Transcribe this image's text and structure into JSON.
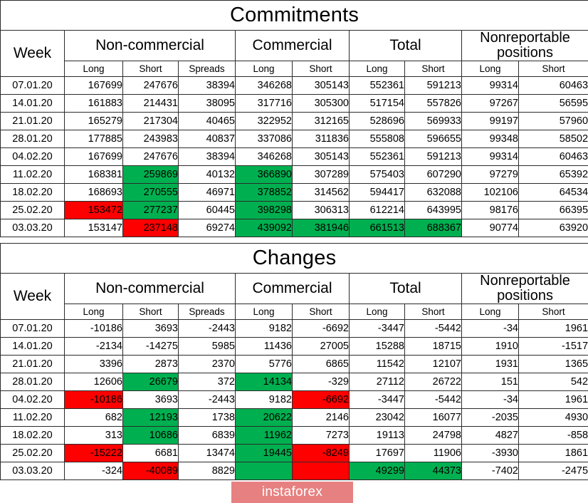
{
  "colors": {
    "highlight_green": "#00b050",
    "highlight_red": "#ff0000",
    "grid": "#2b2b2b",
    "watermark_bg": "#e05c5c"
  },
  "watermark": {
    "label": "instaforex"
  },
  "headers": {
    "week": "Week",
    "groups": {
      "noncommercial": "Non-commercial",
      "commercial": "Commercial",
      "total": "Total",
      "nonreportable_line1": "Nonreportable",
      "nonreportable_line2": "positions"
    },
    "sub": {
      "long": "Long",
      "short": "Short",
      "spreads": "Spreads"
    }
  },
  "tables": [
    {
      "title": "Commitments",
      "columns": [
        "Week",
        "Long",
        "Short",
        "Spreads",
        "Long",
        "Short",
        "Long",
        "Short",
        "Long",
        "Short"
      ],
      "rows": [
        {
          "week": "07.01.20",
          "values": [
            "167699",
            "247676",
            "38394",
            "346268",
            "305143",
            "552361",
            "591213",
            "99314",
            "60463"
          ],
          "highlight": [
            null,
            null,
            null,
            null,
            null,
            null,
            null,
            null,
            null
          ]
        },
        {
          "week": "14.01.20",
          "values": [
            "161883",
            "214431",
            "38095",
            "317716",
            "305300",
            "517154",
            "557826",
            "97267",
            "56595"
          ],
          "highlight": [
            null,
            null,
            null,
            null,
            null,
            null,
            null,
            null,
            null
          ]
        },
        {
          "week": "21.01.20",
          "values": [
            "165279",
            "217304",
            "40465",
            "322952",
            "312165",
            "528696",
            "569933",
            "99197",
            "57960"
          ],
          "highlight": [
            null,
            null,
            null,
            null,
            null,
            null,
            null,
            null,
            null
          ]
        },
        {
          "week": "28.01.20",
          "values": [
            "177885",
            "243983",
            "40837",
            "337086",
            "311836",
            "555808",
            "596655",
            "99348",
            "58502"
          ],
          "highlight": [
            null,
            null,
            null,
            null,
            null,
            null,
            null,
            null,
            null
          ]
        },
        {
          "week": "04.02.20",
          "values": [
            "167699",
            "247676",
            "38394",
            "346268",
            "305143",
            "552361",
            "591213",
            "99314",
            "60463"
          ],
          "highlight": [
            null,
            null,
            null,
            null,
            null,
            null,
            null,
            null,
            null
          ]
        },
        {
          "week": "11.02.20",
          "values": [
            "168381",
            "259869",
            "40132",
            "366890",
            "307289",
            "575403",
            "607290",
            "97279",
            "65392"
          ],
          "highlight": [
            null,
            "green",
            null,
            "green",
            null,
            null,
            null,
            null,
            null
          ]
        },
        {
          "week": "18.02.20",
          "values": [
            "168693",
            "270555",
            "46971",
            "378852",
            "314562",
            "594417",
            "632088",
            "102106",
            "64534"
          ],
          "highlight": [
            null,
            "green",
            null,
            "green",
            null,
            null,
            null,
            null,
            null
          ]
        },
        {
          "week": "25.02.20",
          "values": [
            "153472",
            "277237",
            "60445",
            "398298",
            "306313",
            "612214",
            "643995",
            "98176",
            "66395"
          ],
          "highlight": [
            "red",
            "green",
            null,
            "green",
            null,
            null,
            null,
            null,
            null
          ]
        },
        {
          "week": "03.03.20",
          "values": [
            "153147",
            "237148",
            "69274",
            "439092",
            "381946",
            "661513",
            "688367",
            "90774",
            "63920"
          ],
          "highlight": [
            null,
            "red",
            null,
            "green",
            "green",
            "green",
            "green",
            null,
            null
          ]
        }
      ]
    },
    {
      "title": "Changes",
      "columns": [
        "Week",
        "Long",
        "Short",
        "Spreads",
        "Long",
        "Short",
        "Long",
        "Short",
        "Long",
        "Short"
      ],
      "rows": [
        {
          "week": "07.01.20",
          "values": [
            "-10186",
            "3693",
            "-2443",
            "9182",
            "-6692",
            "-3447",
            "-5442",
            "-34",
            "1961"
          ],
          "highlight": [
            null,
            null,
            null,
            null,
            null,
            null,
            null,
            null,
            null
          ]
        },
        {
          "week": "14.01.20",
          "values": [
            "-2134",
            "-14275",
            "5985",
            "11436",
            "27005",
            "15288",
            "18715",
            "1910",
            "-1517"
          ],
          "highlight": [
            null,
            null,
            null,
            null,
            null,
            null,
            null,
            null,
            null
          ]
        },
        {
          "week": "21.01.20",
          "values": [
            "3396",
            "2873",
            "2370",
            "5776",
            "6865",
            "11542",
            "12107",
            "1931",
            "1365"
          ],
          "highlight": [
            null,
            null,
            null,
            null,
            null,
            null,
            null,
            null,
            null
          ]
        },
        {
          "week": "28.01.20",
          "values": [
            "12606",
            "26679",
            "372",
            "14134",
            "-329",
            "27112",
            "26722",
            "151",
            "542"
          ],
          "highlight": [
            null,
            "green",
            null,
            "green",
            null,
            null,
            null,
            null,
            null
          ]
        },
        {
          "week": "04.02.20",
          "values": [
            "-10186",
            "3693",
            "-2443",
            "9182",
            "-6692",
            "-3447",
            "-5442",
            "-34",
            "1961"
          ],
          "highlight": [
            "red",
            null,
            null,
            null,
            "red",
            null,
            null,
            null,
            null
          ]
        },
        {
          "week": "11.02.20",
          "values": [
            "682",
            "12193",
            "1738",
            "20622",
            "2146",
            "23042",
            "16077",
            "-2035",
            "4930"
          ],
          "highlight": [
            null,
            "green",
            null,
            "green",
            null,
            null,
            null,
            null,
            null
          ]
        },
        {
          "week": "18.02.20",
          "values": [
            "313",
            "10686",
            "6839",
            "11962",
            "7273",
            "19113",
            "24798",
            "4827",
            "-858"
          ],
          "highlight": [
            null,
            "green",
            null,
            "green",
            null,
            null,
            null,
            null,
            null
          ]
        },
        {
          "week": "25.02.20",
          "values": [
            "-15222",
            "6681",
            "13474",
            "19445",
            "-8249",
            "17697",
            "11906",
            "-3930",
            "1861"
          ],
          "highlight": [
            "red",
            null,
            null,
            "green",
            "red",
            null,
            null,
            null,
            null
          ]
        },
        {
          "week": "03.03.20",
          "values": [
            "-324",
            "-40089",
            "8829",
            "",
            "",
            "49299",
            "44373",
            "-7402",
            "-2475"
          ],
          "highlight": [
            null,
            "red",
            null,
            "green",
            "red",
            "green",
            "green",
            null,
            null
          ]
        }
      ]
    }
  ]
}
